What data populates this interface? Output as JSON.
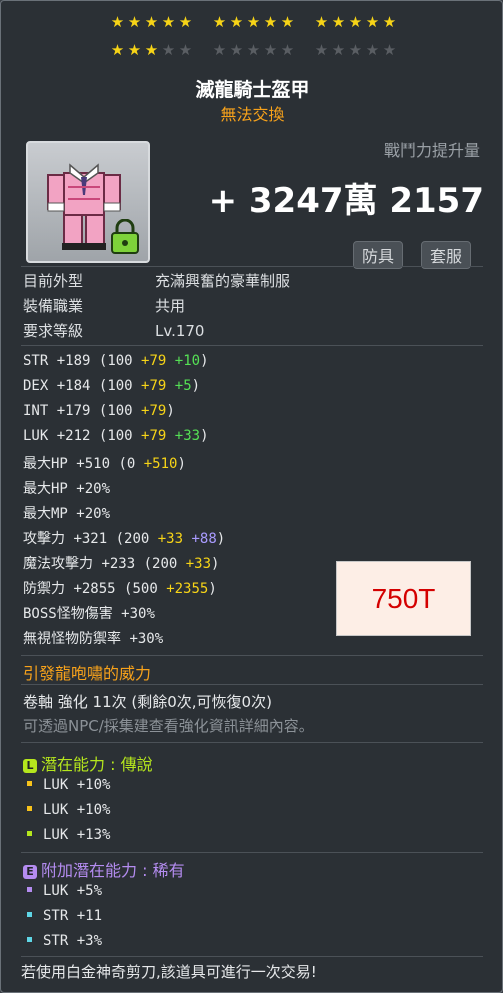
{
  "stars": {
    "row1": {
      "filled": 15,
      "total": 15
    },
    "row2": {
      "filled": 3,
      "total": 15
    }
  },
  "item": {
    "name": "滅龍騎士盔甲",
    "trade_status": "無法交換",
    "icon": "pink-outfit-costume-icon",
    "lock_icon": "green-lock-icon"
  },
  "combat_power": {
    "label": "戰鬥力提升量",
    "value": "+ 3247萬 2157"
  },
  "tags": [
    "防具",
    "套服"
  ],
  "info": [
    {
      "key": "目前外型",
      "value": "充滿興奮的豪華制服"
    },
    {
      "key": "裝備職業",
      "value": "共用"
    },
    {
      "key": "要求等級",
      "value": "Lv.170"
    }
  ],
  "stats": [
    {
      "name": "STR",
      "value": "+189",
      "base": "(100",
      "yellow": "+79",
      "green": "+10",
      "purple": "",
      "close": ")"
    },
    {
      "name": "DEX",
      "value": "+184",
      "base": "(100",
      "yellow": "+79",
      "green": "+5",
      "purple": "",
      "close": ")"
    },
    {
      "name": "INT",
      "value": "+179",
      "base": "(100",
      "yellow": "+79",
      "green": "",
      "purple": "",
      "close": ")"
    },
    {
      "name": "LUK",
      "value": "+212",
      "base": "(100",
      "yellow": "+79",
      "green": "+33",
      "purple": "",
      "close": ")"
    },
    {
      "name": "最大HP",
      "value": "+510",
      "base": "(0",
      "yellow": "+510",
      "green": "",
      "purple": "",
      "close": ")"
    },
    {
      "name": "最大HP",
      "value": "+20%",
      "base": "",
      "yellow": "",
      "green": "",
      "purple": "",
      "close": ""
    },
    {
      "name": "最大MP",
      "value": "+20%",
      "base": "",
      "yellow": "",
      "green": "",
      "purple": "",
      "close": ""
    },
    {
      "name": "攻擊力",
      "value": "+321",
      "base": "(200",
      "yellow": "+33",
      "green": "",
      "purple": "+88",
      "close": ")"
    },
    {
      "name": "魔法攻擊力",
      "value": "+233",
      "base": "(200",
      "yellow": "+33",
      "green": "",
      "purple": "",
      "close": ")"
    },
    {
      "name": "防禦力",
      "value": "+2855",
      "base": "(500",
      "yellow": "+2355",
      "green": "",
      "purple": "",
      "close": ")"
    },
    {
      "name": "BOSS怪物傷害",
      "value": "+30%",
      "base": "",
      "yellow": "",
      "green": "",
      "purple": "",
      "close": ""
    },
    {
      "name": "無視怪物防禦率",
      "value": "+30%",
      "base": "",
      "yellow": "",
      "green": "",
      "purple": "",
      "close": ""
    }
  ],
  "price_note": "750T",
  "set_effect": "引發龍咆嘯的威力",
  "scroll": {
    "line": "卷軸 強化 11次 (剩餘0次,可恢復0次)",
    "hint": "可透過NPC/採集建查看強化資訊詳細內容。"
  },
  "potential": {
    "badge": "L",
    "title": "潛在能力",
    "separator": ":",
    "grade": "傳說",
    "lines": [
      "LUK +10%",
      "LUK +10%",
      "LUK +13%"
    ]
  },
  "additional": {
    "badge": "E",
    "title": "附加潛在能力",
    "separator": ":",
    "grade": "稀有",
    "lines": [
      "LUK +5%",
      "STR +11",
      "STR +3%"
    ]
  },
  "footer": "若使用白金神奇剪刀,該道具可進行一次交易!",
  "colors": {
    "star_on": "#f7d417",
    "star_off": "#5a5e63",
    "untradable": "#f7a21b",
    "legendary": "#b5e61d",
    "epic": "#b48cf0",
    "red_note": "#d40000"
  }
}
